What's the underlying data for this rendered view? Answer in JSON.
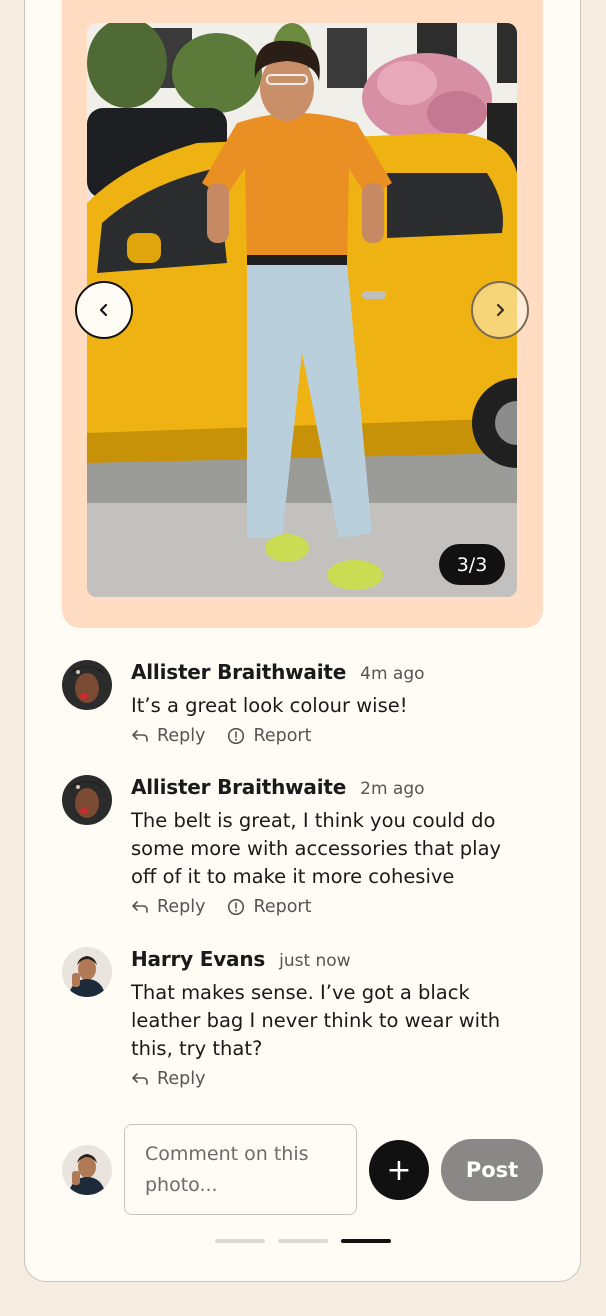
{
  "gallery": {
    "counter": "3/3",
    "prev_icon": "chevron-left-icon",
    "next_icon": "chevron-right-icon"
  },
  "comments": [
    {
      "name": "Allister Braithwaite",
      "time": "4m ago",
      "text": "It’s a great look colour wise!",
      "reply_label": "Reply",
      "report_label": "Report"
    },
    {
      "name": "Allister Braithwaite",
      "time": "2m ago",
      "text": "The belt is great, I think you could do some more with accessories that play off of it to make it more cohesive",
      "reply_label": "Reply",
      "report_label": "Report"
    },
    {
      "name": "Harry Evans",
      "time": "just now",
      "text": "That makes sense. I’ve got a black leather bag I never think to wear with this, try that?",
      "reply_label": "Reply"
    }
  ],
  "composer": {
    "placeholder": "Comment on this photo...",
    "add_symbol": "+",
    "post_label": "Post"
  },
  "pagination": {
    "total": 3,
    "active_index": 2
  },
  "colors": {
    "background": "#f6ecdf",
    "card": "#fffcf5",
    "photo_frame": "#ffdcc2",
    "post_button": "#8a8886",
    "accent_dark": "#111111"
  }
}
